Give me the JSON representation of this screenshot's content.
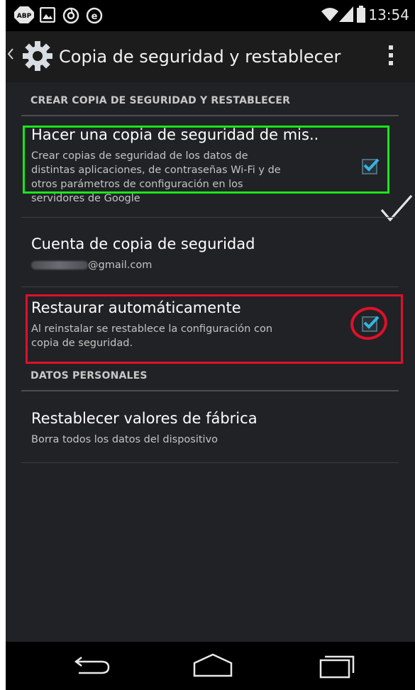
{
  "status_bar": {
    "left_icons": [
      "adblock-plus-icon",
      "image-icon",
      "sync-icon",
      "e-notification-icon"
    ],
    "adblock_text": "ABP",
    "time": "13:54",
    "right_icons": [
      "wifi-icon",
      "signal-icon",
      "battery-icon"
    ]
  },
  "action_bar": {
    "title": "Copia de seguridad y restablecer",
    "icon": "settings-gear-icon"
  },
  "sections": {
    "backup_header": "CREAR COPIA DE SEGURIDAD Y RESTABLECER",
    "personal_header": "DATOS PERSONALES"
  },
  "items": {
    "backup_data": {
      "title": "Hacer una copia de seguridad de mis..",
      "subtitle_lines": [
        "Crear copias de seguridad de los datos de",
        "distintas aplicaciones, de contraseñas Wi-Fi y de",
        "otros parámetros de configuración en los",
        "servidores de Google"
      ],
      "checked": true
    },
    "backup_account": {
      "title": "Cuenta de copia de seguridad",
      "subtitle": "@gmail.com"
    },
    "auto_restore": {
      "title": "Restaurar automáticamente",
      "subtitle_lines": [
        "Al reinstalar se restablece la configuración con",
        "copia de seguridad."
      ],
      "checked": true
    },
    "factory_reset": {
      "title": "Restablecer valores de fábrica",
      "subtitle": "Borra todos los datos del dispositivo"
    }
  },
  "colors": {
    "background": "#202226",
    "highlight_green": "#19e619",
    "highlight_red": "#e0102a",
    "checkmark": "#33b5e5"
  },
  "nav_bar": {
    "buttons": [
      "back-icon",
      "home-icon",
      "recent-apps-icon"
    ]
  }
}
